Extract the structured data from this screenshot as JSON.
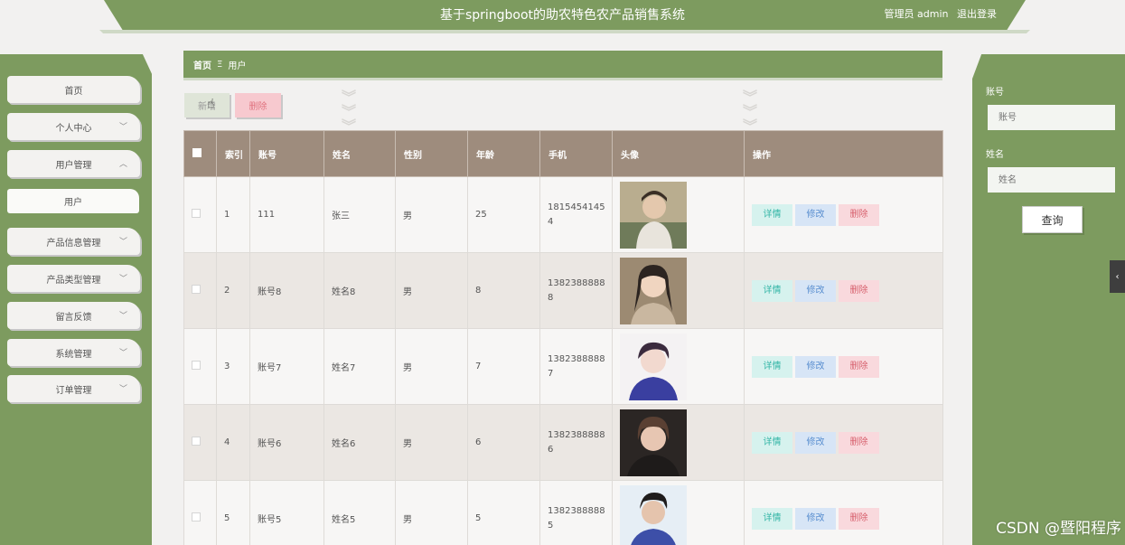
{
  "header": {
    "title": "基于springboot的助农特色农产品销售系统",
    "role": "管理员 admin",
    "logout": "退出登录"
  },
  "sidebar": {
    "items": [
      {
        "label": "首页"
      },
      {
        "label": "个人中心"
      },
      {
        "label": "用户管理"
      },
      {
        "label": "用户"
      },
      {
        "label": "产品信息管理"
      },
      {
        "label": "产品类型管理"
      },
      {
        "label": "留言反馈"
      },
      {
        "label": "系统管理"
      },
      {
        "label": "订单管理"
      }
    ]
  },
  "breadcrumb": {
    "home": "首页",
    "sep": "Ξ",
    "current": "用户"
  },
  "actions": {
    "add": "新增",
    "delete": "删除"
  },
  "table": {
    "headers": [
      "索引",
      "账号",
      "姓名",
      "性别",
      "年龄",
      "手机",
      "头像",
      "操作"
    ],
    "rows": [
      {
        "index": "1",
        "account": "111",
        "name": "张三",
        "gender": "男",
        "age": "25",
        "phone": "18154541454"
      },
      {
        "index": "2",
        "account": "账号8",
        "name": "姓名8",
        "gender": "男",
        "age": "8",
        "phone": "13823888888"
      },
      {
        "index": "3",
        "account": "账号7",
        "name": "姓名7",
        "gender": "男",
        "age": "7",
        "phone": "13823888887"
      },
      {
        "index": "4",
        "account": "账号6",
        "name": "姓名6",
        "gender": "男",
        "age": "6",
        "phone": "13823888886"
      },
      {
        "index": "5",
        "account": "账号5",
        "name": "姓名5",
        "gender": "男",
        "age": "5",
        "phone": "13823888885"
      }
    ],
    "ops": {
      "detail": "详情",
      "edit": "修改",
      "delete": "删除"
    }
  },
  "search": {
    "account_label": "账号",
    "account_placeholder": "账号",
    "name_label": "姓名",
    "name_placeholder": "姓名",
    "button": "查询"
  },
  "watermark": "CSDN @暨阳程序",
  "colors": {
    "primary": "#7d9b5f",
    "table_header": "#9e8c7d"
  }
}
